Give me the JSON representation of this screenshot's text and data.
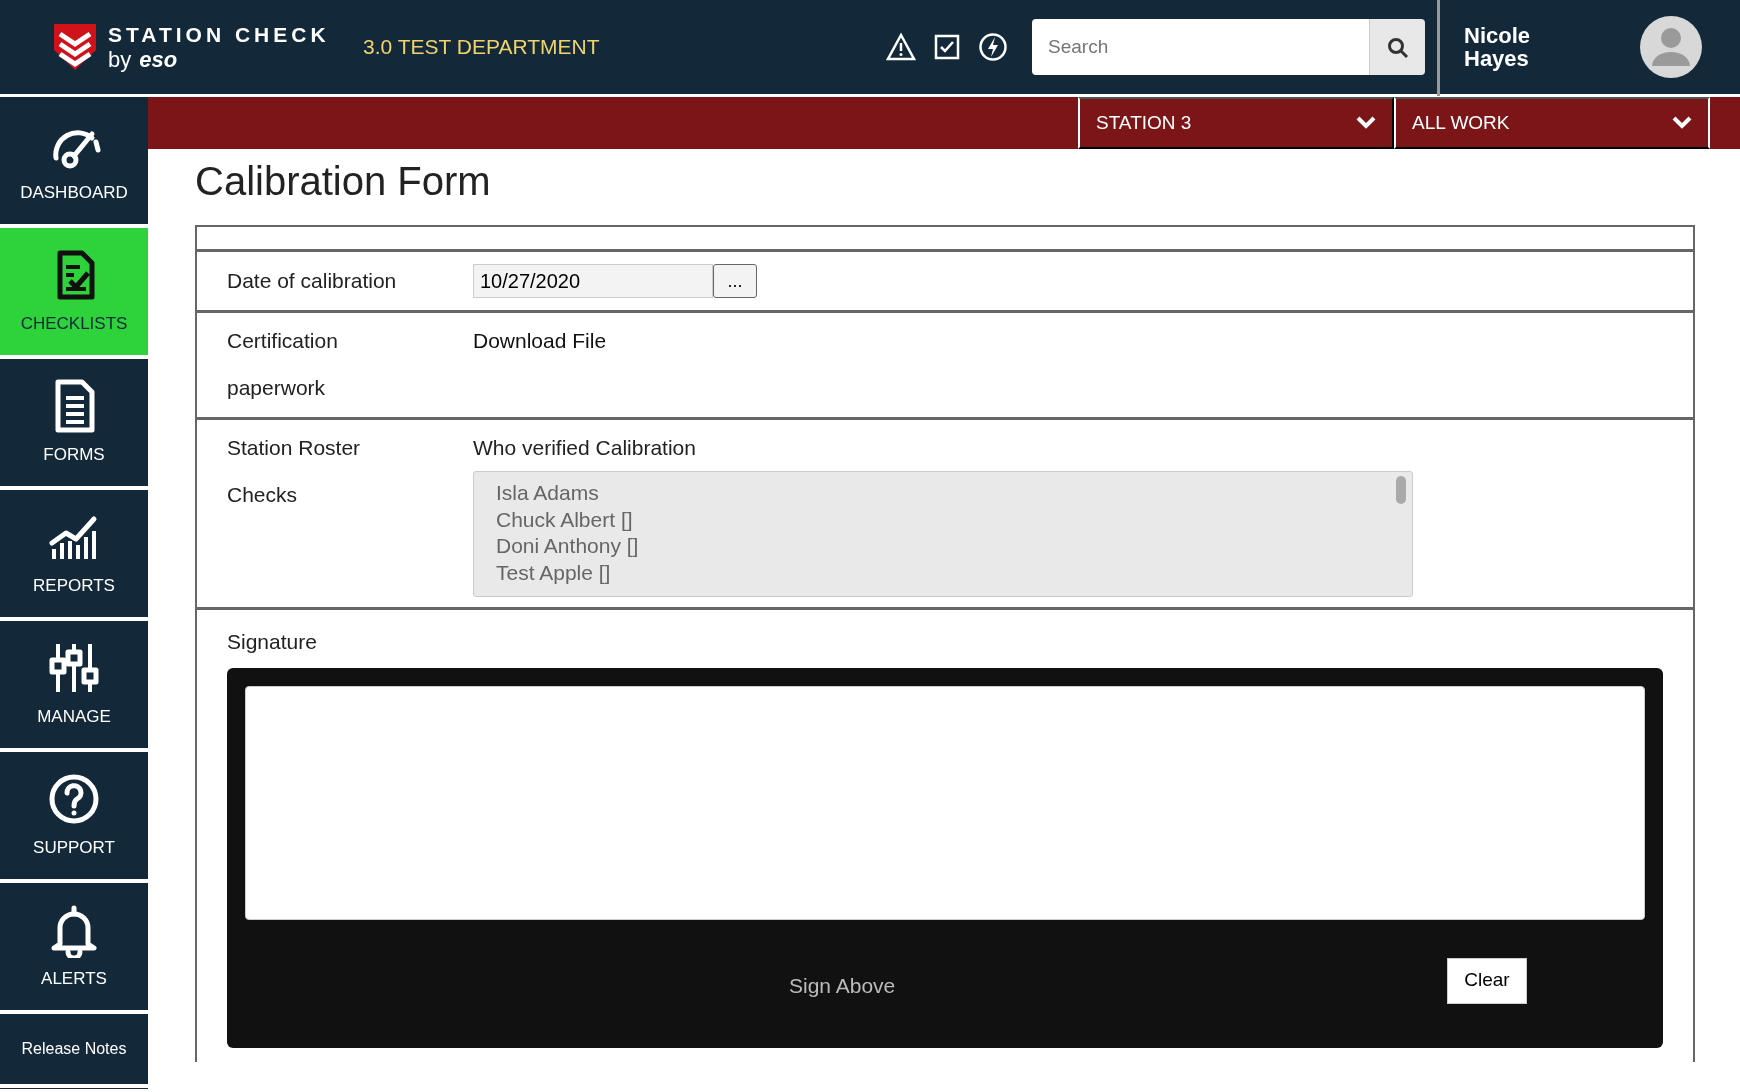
{
  "header": {
    "brand_line1": "STATION CHECK",
    "brand_by": "by",
    "brand_name": "eso",
    "department": "3.0 TEST DEPARTMENT",
    "search": {
      "placeholder": "Search"
    },
    "user_name": "Nicole Hayes"
  },
  "filters": [
    {
      "label": "STATION 3"
    },
    {
      "label": "ALL WORK"
    }
  ],
  "sidebar": {
    "items": [
      {
        "label": "DASHBOARD",
        "kind": "gauge",
        "selected": false
      },
      {
        "label": "CHECKLISTS",
        "kind": "checklist",
        "selected": true
      },
      {
        "label": "FORMS",
        "kind": "document",
        "selected": false
      },
      {
        "label": "REPORTS",
        "kind": "chart",
        "selected": false
      },
      {
        "label": "MANAGE",
        "kind": "sliders",
        "selected": false
      },
      {
        "label": "SUPPORT",
        "kind": "question",
        "selected": false
      },
      {
        "label": "ALERTS",
        "kind": "bell",
        "selected": false
      },
      {
        "label": "Release Notes",
        "kind": "text",
        "selected": false
      }
    ]
  },
  "title": "Calibration Form",
  "form": {
    "date": {
      "label": "Date of calibration",
      "value": "10/27/2020",
      "picker_button": "..."
    },
    "certification": {
      "label_line1": "Certification",
      "label_line2": "paperwork",
      "link": "Download File"
    },
    "roster": {
      "label_line1": "Station Roster",
      "label_line2": "Checks",
      "field_label": "Who verified Calibration",
      "options": [
        "Isla Adams",
        "Chuck Albert []",
        "Doni Anthony []",
        "Test Apple []"
      ]
    },
    "signature": {
      "label": "Signature",
      "hint": "Sign Above",
      "clear_button": "Clear"
    }
  }
}
